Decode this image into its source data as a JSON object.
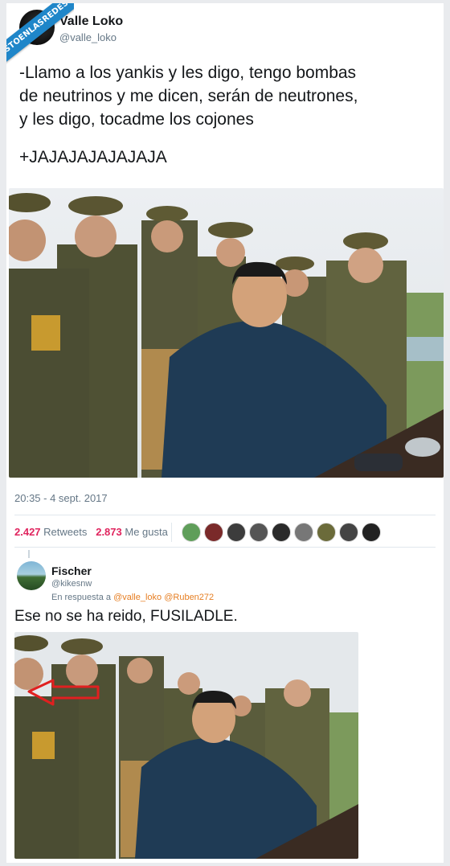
{
  "watermark": "VISTOENLASREDES",
  "tweet": {
    "author_name": "Valle Loko",
    "author_handle": "@valle_loko",
    "text": "-Llamo a los yankis y les digo, tengo bombas\n de neutrinos y me dicen, serán de neutrones,\n y les digo, tocadme los cojones",
    "laugh": "+JAJAJAJAJAJAJA",
    "timestamp": "20:35 - 4 sept. 2017",
    "retweets_count": "2.427",
    "retweets_label": "Retweets",
    "likes_count": "2.873",
    "likes_label": "Me gusta"
  },
  "reply": {
    "author_name": "Fischer",
    "author_handle": "@kikesnw",
    "in_reply_prefix": "En respuesta a",
    "mention1": "@valle_loko",
    "mention2": "@Ruben272",
    "text": "Ese no se ha reido, FUSILADLE."
  },
  "colors": {
    "accent_like": "#e0245e",
    "mention": "#e67e22",
    "watermark": "#1f86c9",
    "arrow": "#e02020"
  }
}
